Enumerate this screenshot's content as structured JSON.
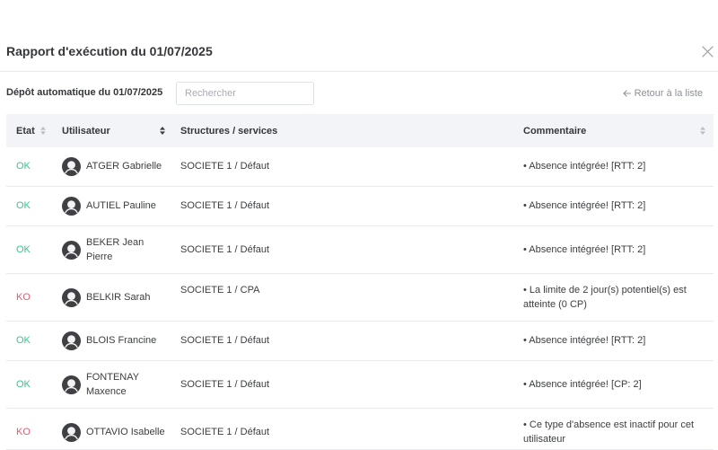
{
  "dialog": {
    "title": "Rapport d'exécution du 01/07/2025",
    "close_icon": "close-icon"
  },
  "toolbar": {
    "deposit_label": "Dépôt automatique du 01/07/2025",
    "search": {
      "placeholder": "Rechercher",
      "value": ""
    },
    "back_icon": "arrow-left-icon",
    "back_label": "Retour à la liste"
  },
  "table": {
    "columns": [
      {
        "label": "Etat",
        "sort_icon": "sort-icon",
        "sort_active": false
      },
      {
        "label": "Utilisateur",
        "sort_icon": "sort-icon",
        "sort_active": true
      },
      {
        "label": "Structures / services",
        "sort_icon": null,
        "sort_active": false
      },
      {
        "label": "Commentaire",
        "sort_icon": "sort-icon",
        "sort_active": false
      }
    ],
    "rows": [
      {
        "status": "OK",
        "user": "ATGER Gabrielle",
        "structure": "SOCIETE 1 / Défaut",
        "comment": "• Absence intégrée! [RTT: 2]"
      },
      {
        "status": "OK",
        "user": "AUTIEL Pauline",
        "structure": "SOCIETE 1 / Défaut",
        "comment": "• Absence intégrée! [RTT: 2]"
      },
      {
        "status": "OK",
        "user": "BEKER Jean Pierre",
        "structure": "SOCIETE 1 / Défaut",
        "comment": "• Absence intégrée! [RTT: 2]"
      },
      {
        "status": "KO",
        "user": "BELKIR Sarah",
        "structure": "SOCIETE 1 / CPA",
        "comment": "• La limite de 2 jour(s) potentiel(s) est atteinte (0 CP)"
      },
      {
        "status": "OK",
        "user": "BLOIS Francine",
        "structure": "SOCIETE 1 / Défaut",
        "comment": "• Absence intégrée! [RTT: 2]"
      },
      {
        "status": "OK",
        "user": "FONTENAY Maxence",
        "structure": "SOCIETE 1 / Défaut",
        "comment": "• Absence intégrée! [CP: 2]"
      },
      {
        "status": "KO",
        "user": "OTTAVIO Isabelle",
        "structure": "SOCIETE 1 / Défaut",
        "comment": "• Ce type d'absence est inactif pour cet utilisateur"
      }
    ]
  },
  "icons": {
    "avatar": "user-avatar-icon"
  },
  "colors": {
    "status": {
      "OK": "#35c88c",
      "KO": "#f0566a"
    },
    "sort_active": "#3a3c40",
    "sort_inactive": "#b9bdc5",
    "header_background": "#f3f4f7"
  }
}
